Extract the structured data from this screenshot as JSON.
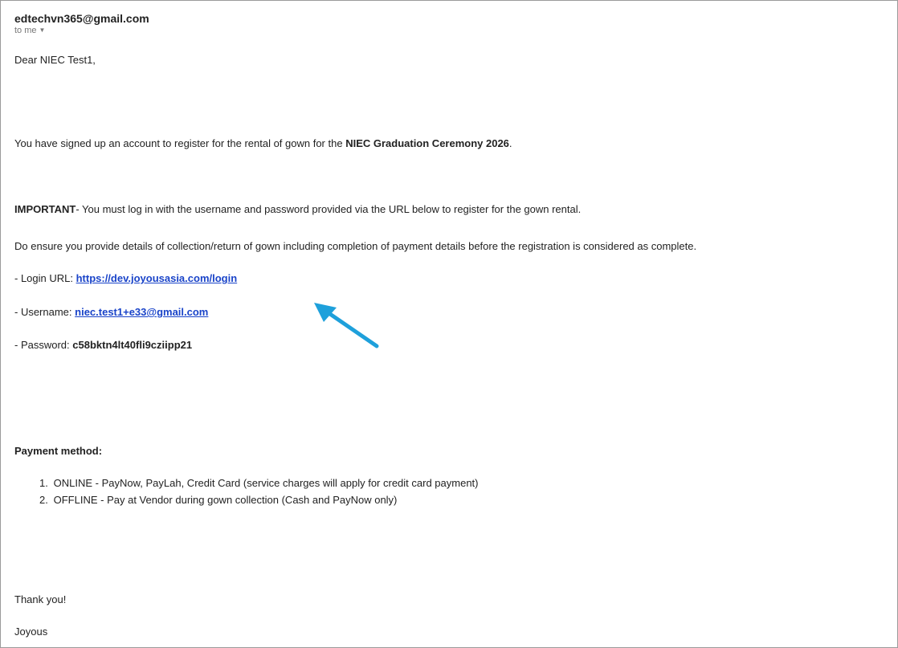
{
  "email": {
    "sender": "edtechvn365@gmail.com",
    "to_line": "to me",
    "greeting": "Dear NIEC Test1,",
    "intro_pre": "You have signed up an account to register for the rental of gown for the ",
    "intro_bold": "NIEC Graduation Ceremony 2026",
    "intro_post": ".",
    "important_label": "IMPORTANT",
    "important_text": "- You must log in with the username and password provided via the URL below to register for the gown rental.",
    "ensure_text": "Do ensure you provide details of collection/return of gown including completion of payment details before the registration is considered as complete.",
    "login_label": "- Login URL: ",
    "login_url": "https://dev.joyousasia.com/login",
    "username_label": "- Username: ",
    "username_value": "niec.test1+e33@gmail.com",
    "password_label": "- Password: ",
    "password_value": "c58bktn4lt40fli9cziipp21",
    "payment_heading": "Payment method:",
    "payment_items": [
      {
        "num": "1.",
        "text": "ONLINE - PayNow, PayLah, Credit Card (service charges will apply for credit card payment)"
      },
      {
        "num": "2.",
        "text": "OFFLINE - Pay at Vendor during gown collection (Cash and PayNow only)"
      }
    ],
    "closing": "Thank you!",
    "signature": "Joyous"
  },
  "colors": {
    "link": "#1a44c9",
    "arrow": "#1ea0db"
  }
}
